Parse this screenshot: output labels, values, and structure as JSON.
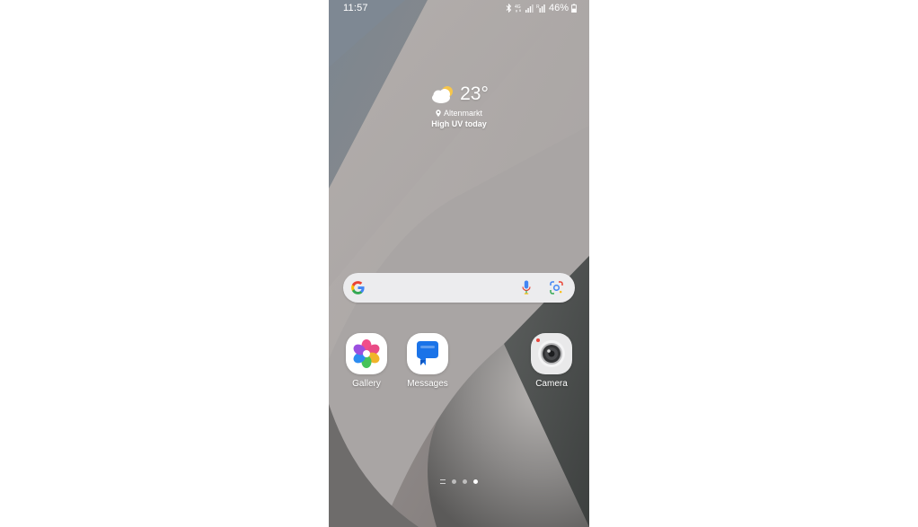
{
  "status_bar": {
    "time": "11:57",
    "battery_percent": "46%",
    "icons": [
      "bluetooth-icon",
      "4g-icon",
      "signal-icon",
      "signal-icon",
      "battery-icon"
    ]
  },
  "weather": {
    "temperature": "23°",
    "location": "Altenmarkt",
    "note": "High UV today",
    "icon": "partly-cloudy-icon"
  },
  "search": {
    "icons": [
      "google-logo-icon",
      "microphone-icon",
      "lens-icon"
    ]
  },
  "apps": [
    {
      "label": "Gallery",
      "icon": "gallery-icon"
    },
    {
      "label": "Messages",
      "icon": "messages-icon"
    },
    {
      "label": "Camera",
      "icon": "camera-icon"
    }
  ],
  "page_indicator": {
    "pages": 3,
    "active_page": 3
  },
  "colors": {
    "google_blue": "#4285F4",
    "google_red": "#EA4335",
    "google_yellow": "#FBBC05",
    "google_green": "#34A853",
    "messages_blue": "#1a73e8"
  }
}
